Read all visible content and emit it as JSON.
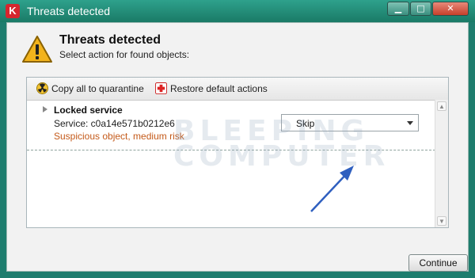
{
  "window": {
    "title": "Threats detected",
    "controls": {
      "minimize": "▁",
      "maximize": "□",
      "close": "✕"
    },
    "icon": "kaspersky-logo-icon"
  },
  "header": {
    "title": "Threats detected",
    "subtitle": "Select action for found objects:",
    "icon": "warning-icon"
  },
  "toolbar": {
    "quarantine_label": "Copy all to quarantine",
    "restore_label": "Restore default actions"
  },
  "threat_item": {
    "name": "Locked service",
    "service": "Service: c0a14e571b0212e6",
    "risk": "Suspicious object, medium risk",
    "action_selected": "Skip"
  },
  "watermark": {
    "line1": "BLEEPING",
    "line2": "COMPUTER"
  },
  "footer": {
    "continue_label": "Continue"
  },
  "colors": {
    "accent": "#1e7d6e",
    "risk_text": "#c45a1a",
    "annotation_arrow": "#2f5fbf"
  }
}
